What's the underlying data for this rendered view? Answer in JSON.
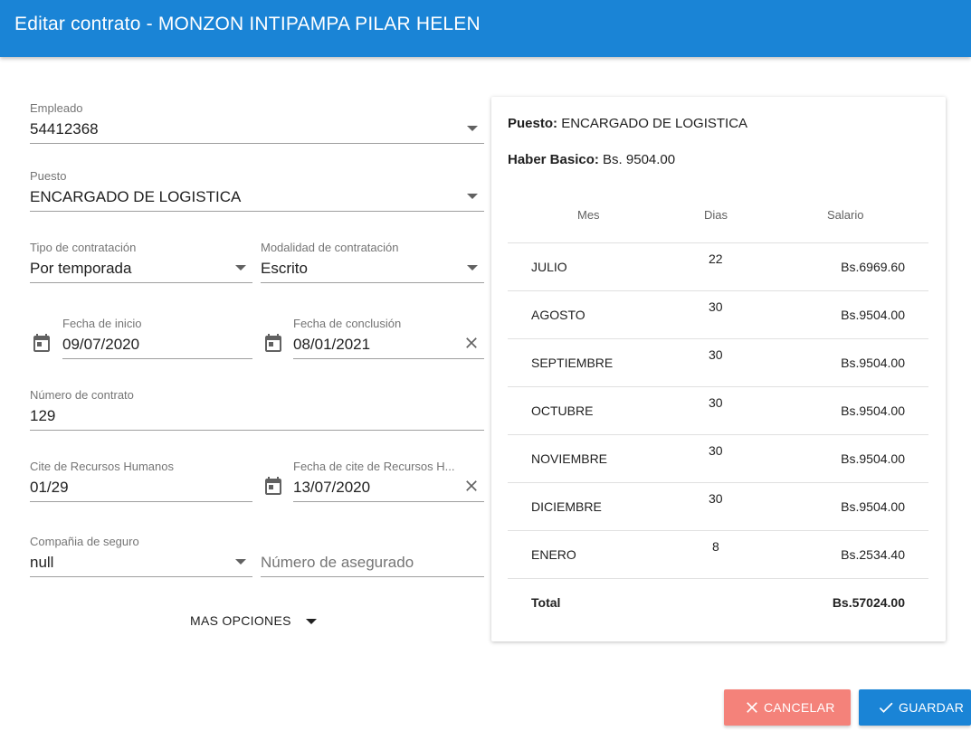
{
  "header": {
    "title": "Editar contrato - MONZON INTIPAMPA PILAR HELEN"
  },
  "form": {
    "empleado": {
      "label": "Empleado",
      "value": "54412368"
    },
    "puesto": {
      "label": "Puesto",
      "value": "ENCARGADO DE LOGISTICA"
    },
    "tipo_contratacion": {
      "label": "Tipo de contratación",
      "value": "Por temporada"
    },
    "modalidad": {
      "label": "Modalidad de contratación",
      "value": "Escrito"
    },
    "fecha_inicio": {
      "label": "Fecha de inicio",
      "value": "09/07/2020"
    },
    "fecha_conclusion": {
      "label": "Fecha de conclusión",
      "value": "08/01/2021"
    },
    "numero_contrato": {
      "label": "Número de contrato",
      "value": "129"
    },
    "cite_rrhh": {
      "label": "Cite de Recursos Humanos",
      "value": "01/29"
    },
    "fecha_cite": {
      "label": "Fecha de cite de Recursos H...",
      "value": "13/07/2020"
    },
    "compania_seguro": {
      "label": "Compañia de seguro",
      "value": "null"
    },
    "numero_asegurado": {
      "placeholder": "Número de asegurado"
    },
    "mas_opciones": "MAS OPCIONES"
  },
  "summary": {
    "puesto_label": "Puesto:",
    "puesto_value": "ENCARGADO DE LOGISTICA",
    "haber_label": "Haber Basico:",
    "haber_value": "Bs. 9504.00",
    "columns": {
      "mes": "Mes",
      "dias": "Dias",
      "salario": "Salario"
    },
    "rows": [
      {
        "mes": "JULIO",
        "dias": "22",
        "salario": "Bs.6969.60"
      },
      {
        "mes": "AGOSTO",
        "dias": "30",
        "salario": "Bs.9504.00"
      },
      {
        "mes": "SEPTIEMBRE",
        "dias": "30",
        "salario": "Bs.9504.00"
      },
      {
        "mes": "OCTUBRE",
        "dias": "30",
        "salario": "Bs.9504.00"
      },
      {
        "mes": "NOVIEMBRE",
        "dias": "30",
        "salario": "Bs.9504.00"
      },
      {
        "mes": "DICIEMBRE",
        "dias": "30",
        "salario": "Bs.9504.00"
      },
      {
        "mes": "ENERO",
        "dias": "8",
        "salario": "Bs.2534.40"
      }
    ],
    "total_label": "Total",
    "total_value": "Bs.57024.00"
  },
  "actions": {
    "cancel": "CANCELAR",
    "save": "GUARDAR"
  },
  "colors": {
    "primary": "#1a84d6",
    "cancel": "#f4827a"
  },
  "icons": [
    "calendar-icon",
    "close-icon",
    "check-icon",
    "dropdown-caret-icon"
  ]
}
